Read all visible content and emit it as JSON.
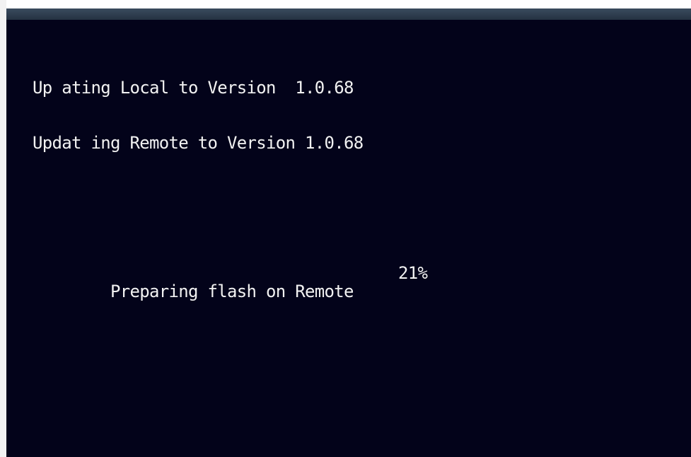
{
  "console": {
    "lines": [
      "Up ating Local to Version  1.0.68",
      "Updat ing Remote to Version 1.0.68"
    ],
    "status": {
      "label": "Preparing flash on Remote",
      "percent": "21%"
    }
  },
  "colors": {
    "screen_background": "#03031a",
    "text": "#f2f2f2",
    "top_bar": "#2f3e50"
  }
}
